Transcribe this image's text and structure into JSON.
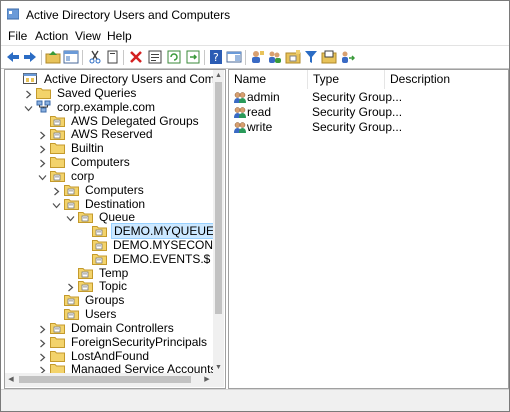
{
  "window": {
    "title": "Active Directory Users and Computers"
  },
  "menu": [
    "File",
    "Action",
    "View",
    "Help"
  ],
  "tree": [
    {
      "label": "Active Directory Users and Computers [WIN-IL",
      "level": 0,
      "chevron": "",
      "icon": "console-icon"
    },
    {
      "label": "Saved Queries",
      "level": 1,
      "chevron": "right",
      "icon": "folder-icon"
    },
    {
      "label": "corp.example.com",
      "level": 1,
      "chevron": "down",
      "icon": "domain-icon"
    },
    {
      "label": "AWS Delegated Groups",
      "level": 2,
      "chevron": "",
      "icon": "ou-icon"
    },
    {
      "label": "AWS Reserved",
      "level": 2,
      "chevron": "right",
      "icon": "ou-icon"
    },
    {
      "label": "Builtin",
      "level": 2,
      "chevron": "right",
      "icon": "folder-icon"
    },
    {
      "label": "Computers",
      "level": 2,
      "chevron": "right",
      "icon": "folder-icon"
    },
    {
      "label": "corp",
      "level": 2,
      "chevron": "down",
      "icon": "ou-icon"
    },
    {
      "label": "Computers",
      "level": 3,
      "chevron": "right",
      "icon": "ou-icon"
    },
    {
      "label": "Destination",
      "level": 3,
      "chevron": "down",
      "icon": "ou-icon"
    },
    {
      "label": "Queue",
      "level": 4,
      "chevron": "down",
      "icon": "ou-icon"
    },
    {
      "label": "DEMO.MYQUEUE",
      "level": 5,
      "chevron": "",
      "icon": "ou-icon",
      "selected": true
    },
    {
      "label": "DEMO.MYSECONDQUEUE",
      "level": 5,
      "chevron": "",
      "icon": "ou-icon"
    },
    {
      "label": "DEMO.EVENTS.$",
      "level": 5,
      "chevron": "",
      "icon": "ou-icon"
    },
    {
      "label": "Temp",
      "level": 4,
      "chevron": "",
      "icon": "ou-icon"
    },
    {
      "label": "Topic",
      "level": 4,
      "chevron": "right",
      "icon": "ou-icon"
    },
    {
      "label": "Groups",
      "level": 3,
      "chevron": "",
      "icon": "ou-icon"
    },
    {
      "label": "Users",
      "level": 3,
      "chevron": "",
      "icon": "ou-icon"
    },
    {
      "label": "Domain Controllers",
      "level": 2,
      "chevron": "right",
      "icon": "ou-icon"
    },
    {
      "label": "ForeignSecurityPrincipals",
      "level": 2,
      "chevron": "right",
      "icon": "folder-icon"
    },
    {
      "label": "LostAndFound",
      "level": 2,
      "chevron": "right",
      "icon": "folder-icon"
    },
    {
      "label": "Managed Service Accounts",
      "level": 2,
      "chevron": "right",
      "icon": "folder-icon"
    }
  ],
  "list": {
    "columns": [
      "Name",
      "Type",
      "Description"
    ],
    "rows": [
      {
        "name": "admin",
        "type": "Security Group...",
        "description": ""
      },
      {
        "name": "read",
        "type": "Security Group...",
        "description": ""
      },
      {
        "name": "write",
        "type": "Security Group...",
        "description": ""
      }
    ]
  },
  "colors": {
    "selection": "#cce8ff",
    "folder": "#e8c35a",
    "accent_blue": "#2b6cc4",
    "red_x": "#d42020"
  },
  "toolbar_icons": [
    "back-icon",
    "forward-icon",
    "up-folder-icon",
    "show-pane-icon",
    "cut-icon",
    "copy-icon",
    "delete-icon",
    "properties-icon",
    "refresh-icon",
    "export-icon",
    "help-icon",
    "detail-pane-icon",
    "new-user-icon",
    "new-group-icon",
    "new-ou-icon",
    "filter-icon",
    "add-to-group-icon",
    "move-icon"
  ]
}
